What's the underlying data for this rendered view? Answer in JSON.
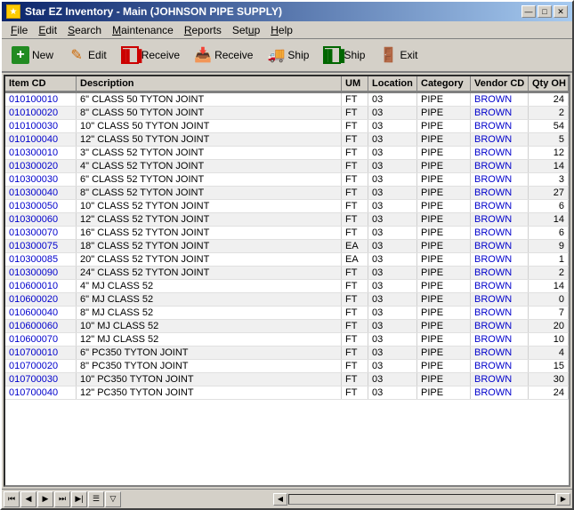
{
  "window": {
    "title": "Star EZ Inventory - Main (JOHNSON PIPE SUPPLY)",
    "title_icon": "★"
  },
  "title_buttons": {
    "minimize": "—",
    "maximize": "□",
    "close": "✕"
  },
  "menu": {
    "items": [
      {
        "id": "file",
        "label": "File",
        "underline_index": 0
      },
      {
        "id": "edit",
        "label": "Edit",
        "underline_index": 0
      },
      {
        "id": "search",
        "label": "Search",
        "underline_index": 0
      },
      {
        "id": "maintenance",
        "label": "Maintenance",
        "underline_index": 0
      },
      {
        "id": "reports",
        "label": "Reports",
        "underline_index": 0
      },
      {
        "id": "setup",
        "label": "Setup",
        "underline_index": 0
      },
      {
        "id": "help",
        "label": "Help",
        "underline_index": 0
      }
    ]
  },
  "toolbar": {
    "buttons": [
      {
        "id": "new",
        "label": "New",
        "icon": "+"
      },
      {
        "id": "edit",
        "label": "Edit",
        "icon": "✏"
      },
      {
        "id": "receive-barcode",
        "label": "Receive",
        "icon": "▦"
      },
      {
        "id": "receive-text",
        "label": "Receive",
        "icon": "▦"
      },
      {
        "id": "ship-barcode",
        "label": "Ship",
        "icon": "▦"
      },
      {
        "id": "ship-text",
        "label": "Ship",
        "icon": "▦"
      },
      {
        "id": "exit",
        "label": "Exit",
        "icon": "🚪"
      }
    ]
  },
  "table": {
    "columns": [
      {
        "id": "item-cd",
        "label": "Item CD"
      },
      {
        "id": "description",
        "label": "Description"
      },
      {
        "id": "um",
        "label": "UM"
      },
      {
        "id": "location",
        "label": "Location"
      },
      {
        "id": "category",
        "label": "Category"
      },
      {
        "id": "vendor-cd",
        "label": "Vendor CD"
      },
      {
        "id": "qty-oh",
        "label": "Qty OH"
      }
    ],
    "rows": [
      {
        "item_cd": "010100010",
        "description": "6\" CLASS 50 TYTON JOINT",
        "um": "FT",
        "location": "03",
        "category": "PIPE",
        "vendor_cd": "BROWN",
        "qty_oh": "24"
      },
      {
        "item_cd": "010100020",
        "description": "8\" CLASS 50 TYTON JOINT",
        "um": "FT",
        "location": "03",
        "category": "PIPE",
        "vendor_cd": "BROWN",
        "qty_oh": "2"
      },
      {
        "item_cd": "010100030",
        "description": "10\" CLASS 50 TYTON JOINT",
        "um": "FT",
        "location": "03",
        "category": "PIPE",
        "vendor_cd": "BROWN",
        "qty_oh": "54"
      },
      {
        "item_cd": "010100040",
        "description": "12\" CLASS 50 TYTON JOINT",
        "um": "FT",
        "location": "03",
        "category": "PIPE",
        "vendor_cd": "BROWN",
        "qty_oh": "5"
      },
      {
        "item_cd": "010300010",
        "description": "3\" CLASS 52 TYTON JOINT",
        "um": "FT",
        "location": "03",
        "category": "PIPE",
        "vendor_cd": "BROWN",
        "qty_oh": "12"
      },
      {
        "item_cd": "010300020",
        "description": "4\" CLASS 52 TYTON JOINT",
        "um": "FT",
        "location": "03",
        "category": "PIPE",
        "vendor_cd": "BROWN",
        "qty_oh": "14"
      },
      {
        "item_cd": "010300030",
        "description": "6\" CLASS 52 TYTON JOINT",
        "um": "FT",
        "location": "03",
        "category": "PIPE",
        "vendor_cd": "BROWN",
        "qty_oh": "3"
      },
      {
        "item_cd": "010300040",
        "description": "8\" CLASS 52 TYTON JOINT",
        "um": "FT",
        "location": "03",
        "category": "PIPE",
        "vendor_cd": "BROWN",
        "qty_oh": "27"
      },
      {
        "item_cd": "010300050",
        "description": "10\" CLASS 52 TYTON JOINT",
        "um": "FT",
        "location": "03",
        "category": "PIPE",
        "vendor_cd": "BROWN",
        "qty_oh": "6"
      },
      {
        "item_cd": "010300060",
        "description": "12\" CLASS 52 TYTON JOINT",
        "um": "FT",
        "location": "03",
        "category": "PIPE",
        "vendor_cd": "BROWN",
        "qty_oh": "14"
      },
      {
        "item_cd": "010300070",
        "description": "16\" CLASS 52 TYTON JOINT",
        "um": "FT",
        "location": "03",
        "category": "PIPE",
        "vendor_cd": "BROWN",
        "qty_oh": "6"
      },
      {
        "item_cd": "010300075",
        "description": "18\" CLASS 52 TYTON JOINT",
        "um": "EA",
        "location": "03",
        "category": "PIPE",
        "vendor_cd": "BROWN",
        "qty_oh": "9"
      },
      {
        "item_cd": "010300085",
        "description": "20\" CLASS 52 TYTON JOINT",
        "um": "EA",
        "location": "03",
        "category": "PIPE",
        "vendor_cd": "BROWN",
        "qty_oh": "1"
      },
      {
        "item_cd": "010300090",
        "description": "24\" CLASS 52 TYTON JOINT",
        "um": "FT",
        "location": "03",
        "category": "PIPE",
        "vendor_cd": "BROWN",
        "qty_oh": "2"
      },
      {
        "item_cd": "010600010",
        "description": "4\" MJ CLASS 52",
        "um": "FT",
        "location": "03",
        "category": "PIPE",
        "vendor_cd": "BROWN",
        "qty_oh": "14"
      },
      {
        "item_cd": "010600020",
        "description": "6\" MJ CLASS 52",
        "um": "FT",
        "location": "03",
        "category": "PIPE",
        "vendor_cd": "BROWN",
        "qty_oh": "0"
      },
      {
        "item_cd": "010600040",
        "description": "8\" MJ CLASS 52",
        "um": "FT",
        "location": "03",
        "category": "PIPE",
        "vendor_cd": "BROWN",
        "qty_oh": "7"
      },
      {
        "item_cd": "010600060",
        "description": "10\" MJ CLASS 52",
        "um": "FT",
        "location": "03",
        "category": "PIPE",
        "vendor_cd": "BROWN",
        "qty_oh": "20"
      },
      {
        "item_cd": "010600070",
        "description": "12\" MJ CLASS 52",
        "um": "FT",
        "location": "03",
        "category": "PIPE",
        "vendor_cd": "BROWN",
        "qty_oh": "10"
      },
      {
        "item_cd": "010700010",
        "description": "6\" PC350 TYTON JOINT",
        "um": "FT",
        "location": "03",
        "category": "PIPE",
        "vendor_cd": "BROWN",
        "qty_oh": "4"
      },
      {
        "item_cd": "010700020",
        "description": "8\" PC350 TYTON JOINT",
        "um": "FT",
        "location": "03",
        "category": "PIPE",
        "vendor_cd": "BROWN",
        "qty_oh": "15"
      },
      {
        "item_cd": "010700030",
        "description": "10\" PC350 TYTON JOINT",
        "um": "FT",
        "location": "03",
        "category": "PIPE",
        "vendor_cd": "BROWN",
        "qty_oh": "30"
      },
      {
        "item_cd": "010700040",
        "description": "12\" PC350 TYTON JOINT",
        "um": "FT",
        "location": "03",
        "category": "PIPE",
        "vendor_cd": "BROWN",
        "qty_oh": "24"
      }
    ]
  },
  "nav_bar": {
    "buttons": [
      "⏮",
      "◀",
      "▶",
      "⏭",
      "▶|",
      "☰",
      "🔽"
    ]
  }
}
